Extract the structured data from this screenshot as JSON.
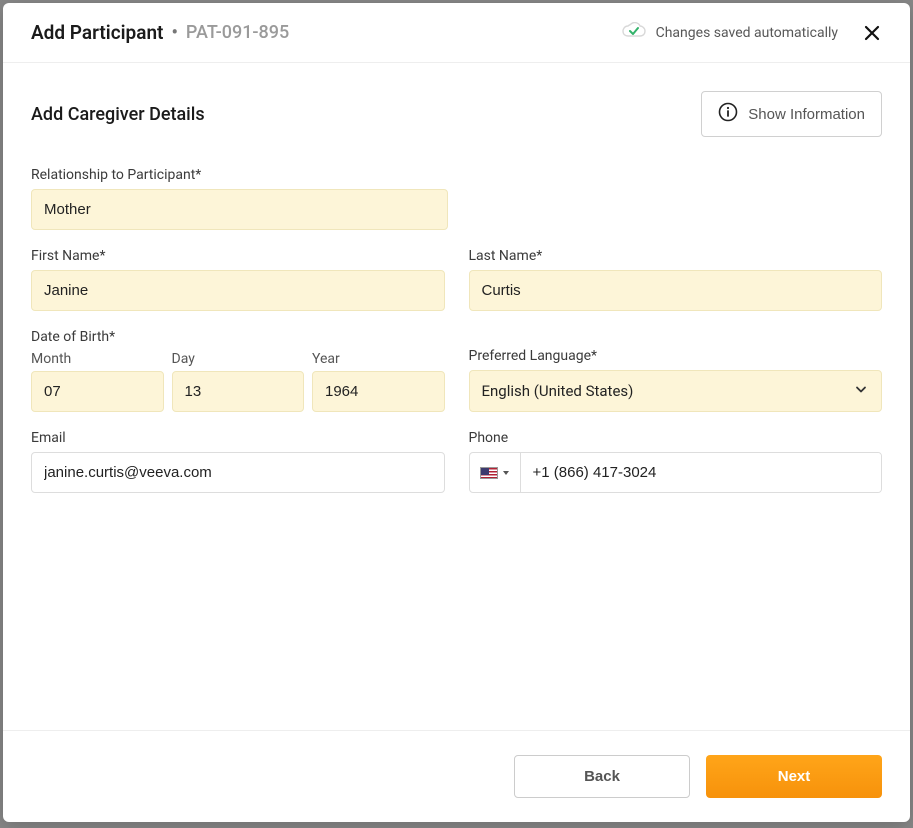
{
  "header": {
    "title": "Add Participant",
    "pat_id": "PAT-091-895",
    "autosave": "Changes saved automatically"
  },
  "section": {
    "title": "Add Caregiver Details",
    "show_info": "Show Information"
  },
  "labels": {
    "relationship": "Relationship to Participant*",
    "first_name": "First Name*",
    "last_name": "Last Name*",
    "dob": "Date of Birth*",
    "month": "Month",
    "day": "Day",
    "year": "Year",
    "language": "Preferred Language*",
    "email": "Email",
    "phone": "Phone"
  },
  "values": {
    "relationship": "Mother",
    "first_name": "Janine",
    "last_name": "Curtis",
    "month": "07",
    "day": "13",
    "year": "1964",
    "language": "English (United States)",
    "email": "janine.curtis@veeva.com",
    "phone": "+1 (866) 417-3024"
  },
  "footer": {
    "back": "Back",
    "next": "Next"
  }
}
